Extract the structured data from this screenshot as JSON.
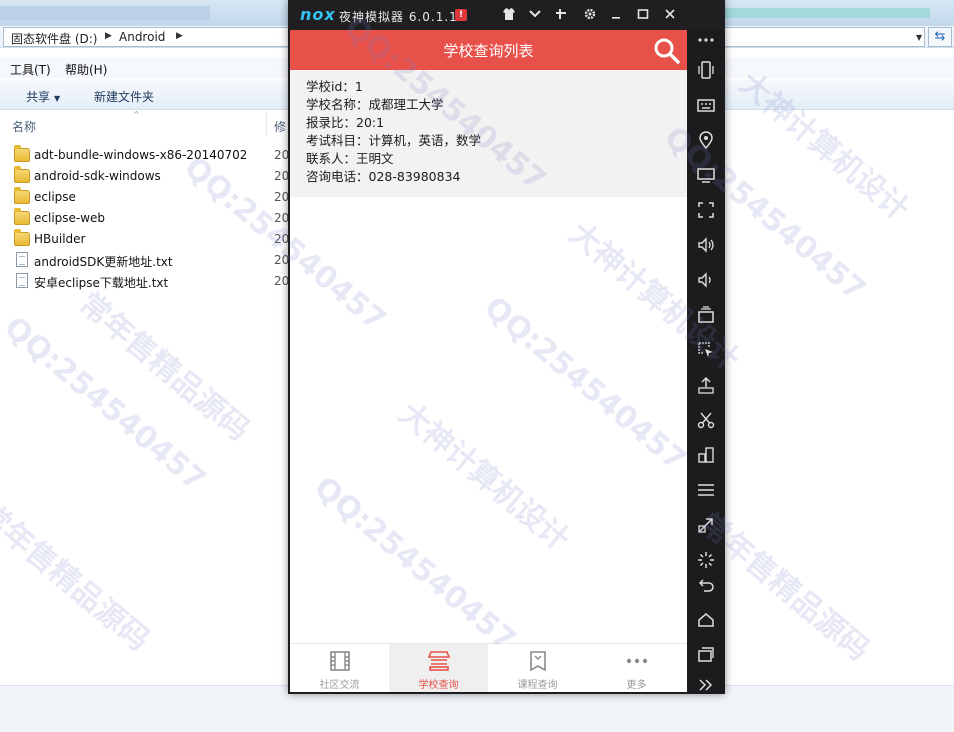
{
  "explorer": {
    "breadcrumb": [
      "固态软件盘 (D:)",
      "Android"
    ],
    "menu": [
      "工具(T)",
      "帮助(H)"
    ],
    "commands": [
      "共享",
      "新建文件夹"
    ],
    "columns": [
      "名称",
      "修"
    ],
    "files": [
      {
        "name": "adt-bundle-windows-x86-20140702",
        "date": "20",
        "type": "folder"
      },
      {
        "name": "android-sdk-windows",
        "date": "20",
        "type": "folder"
      },
      {
        "name": "eclipse",
        "date": "20",
        "type": "folder"
      },
      {
        "name": "eclipse-web",
        "date": "20",
        "type": "folder"
      },
      {
        "name": "HBuilder",
        "date": "20",
        "type": "folder"
      },
      {
        "name": "androidSDK更新地址.txt",
        "date": "20",
        "type": "txt"
      },
      {
        "name": "安卓eclipse下载地址.txt",
        "date": "20",
        "type": "txt"
      }
    ]
  },
  "emulator": {
    "logo": "nox",
    "title": "夜神模拟器 6.0.1.1",
    "alert": "!"
  },
  "app": {
    "title": "学校查询列表",
    "record": {
      "id_line": "学校id：1",
      "name_line": "学校名称：成都理工大学",
      "ratio_line": "报录比：20:1",
      "subjects_line": "考试科目：计算机，英语，数学",
      "contact_line": "联系人：王明文",
      "phone_line": "咨询电话：028-83980834"
    },
    "nav": [
      {
        "label": "社区交流",
        "icon": "film-icon",
        "active": false
      },
      {
        "label": "学校查询",
        "icon": "school-icon",
        "active": true
      },
      {
        "label": "课程查询",
        "icon": "book-icon",
        "active": false
      },
      {
        "label": "更多",
        "icon": "more-dots-icon",
        "active": false
      }
    ],
    "accent": "#e8504a"
  },
  "watermarks": [
    "QQ:254540457",
    "大神计算机设计",
    "常年售精品源码"
  ]
}
